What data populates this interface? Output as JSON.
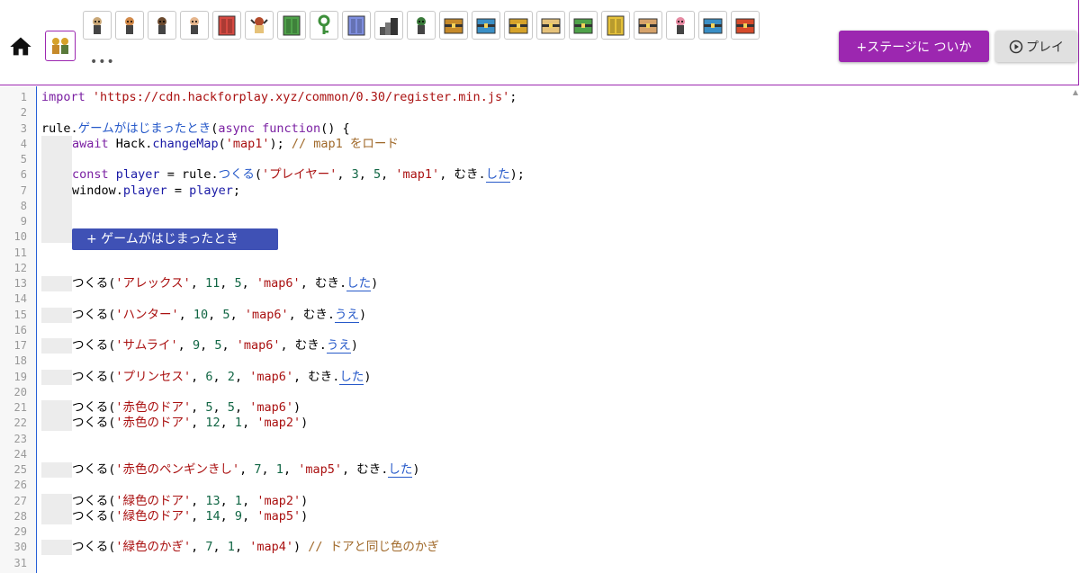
{
  "toolbar": {
    "add_stage_label": "+ステージに ついか",
    "play_label": "プレイ",
    "more_label": "•••",
    "assets": [
      {
        "name": "asset-person-1",
        "icon": "person",
        "color": "#c9a777"
      },
      {
        "name": "asset-person-2",
        "icon": "person",
        "color": "#d28a4a"
      },
      {
        "name": "asset-person-3",
        "icon": "person",
        "color": "#6b4a2f"
      },
      {
        "name": "asset-person-4",
        "icon": "person",
        "color": "#e5b58c"
      },
      {
        "name": "asset-red-door",
        "icon": "door",
        "color": "#d64a42"
      },
      {
        "name": "asset-penguin-knight",
        "icon": "knight",
        "color": "#b24a2a"
      },
      {
        "name": "asset-green-door",
        "icon": "door",
        "color": "#4fa24a"
      },
      {
        "name": "asset-green-key",
        "icon": "key",
        "color": "#3d8f3a"
      },
      {
        "name": "asset-blue-door",
        "icon": "door",
        "color": "#7f8fe0"
      },
      {
        "name": "asset-stairs",
        "icon": "stairs",
        "color": "#555555"
      },
      {
        "name": "asset-goblin",
        "icon": "person",
        "color": "#3a7a3a"
      },
      {
        "name": "asset-chest-1",
        "icon": "chest",
        "color": "#c68a2a"
      },
      {
        "name": "asset-chest-2",
        "icon": "chest",
        "color": "#3a8fc6"
      },
      {
        "name": "asset-chest-3",
        "icon": "chest",
        "color": "#d6a22a"
      },
      {
        "name": "asset-chest-4",
        "icon": "chest",
        "color": "#e6c27a"
      },
      {
        "name": "asset-chest-5",
        "icon": "chest",
        "color": "#4fa24a"
      },
      {
        "name": "asset-yellow-door",
        "icon": "door",
        "color": "#e6c23a"
      },
      {
        "name": "asset-chest-6",
        "icon": "chest",
        "color": "#d6a26a"
      },
      {
        "name": "asset-princess",
        "icon": "person",
        "color": "#e68aa2"
      },
      {
        "name": "asset-chest-7",
        "icon": "chest",
        "color": "#3a8fc6"
      },
      {
        "name": "asset-chest-8",
        "icon": "chest",
        "color": "#d64a2a"
      }
    ]
  },
  "editor": {
    "snippet_button_label": "+ ゲームがはじまったとき",
    "line_numbers": [
      "1",
      "2",
      "3",
      "4",
      "5",
      "6",
      "7",
      "8",
      "9",
      "10",
      "11",
      "12",
      "13",
      "14",
      "15",
      "16",
      "17",
      "18",
      "19",
      "20",
      "21",
      "22",
      "23",
      "24",
      "25",
      "26",
      "27",
      "28",
      "29",
      "30",
      "31"
    ],
    "lines": [
      {
        "n": 1,
        "indent": 0,
        "tokens": [
          [
            "kw",
            "import"
          ],
          [
            "",
            " "
          ],
          [
            "str",
            "'https://cdn.hackforplay.xyz/common/0.30/register.min.js'"
          ],
          [
            "",
            ";"
          ]
        ]
      },
      {
        "n": 2,
        "indent": 0,
        "tokens": []
      },
      {
        "n": 3,
        "indent": 0,
        "tokens": [
          [
            "",
            "rule."
          ],
          [
            "jp",
            "ゲームがはじまったとき"
          ],
          [
            "",
            "("
          ],
          [
            "kw",
            "async"
          ],
          [
            "",
            " "
          ],
          [
            "kw",
            "function"
          ],
          [
            "",
            "() {"
          ]
        ]
      },
      {
        "n": 4,
        "indent": 1,
        "tokens": [
          [
            "kw",
            "await"
          ],
          [
            "",
            " Hack."
          ],
          [
            "var",
            "changeMap"
          ],
          [
            "",
            "("
          ],
          [
            "str",
            "'map1'"
          ],
          [
            "",
            "); "
          ],
          [
            "cmt",
            "// map1 をロード"
          ]
        ]
      },
      {
        "n": 5,
        "indent": 1,
        "tokens": []
      },
      {
        "n": 6,
        "indent": 1,
        "tokens": [
          [
            "kw",
            "const"
          ],
          [
            "",
            " "
          ],
          [
            "var",
            "player"
          ],
          [
            "",
            " = rule."
          ],
          [
            "jp",
            "つくる"
          ],
          [
            "",
            "("
          ],
          [
            "str",
            "'プレイヤー'"
          ],
          [
            "",
            ", "
          ],
          [
            "num",
            "3"
          ],
          [
            "",
            ", "
          ],
          [
            "num",
            "5"
          ],
          [
            "",
            ", "
          ],
          [
            "str",
            "'map1'"
          ],
          [
            "",
            ", むき."
          ],
          [
            "ul",
            "した"
          ],
          [
            "",
            ");"
          ]
        ]
      },
      {
        "n": 7,
        "indent": 1,
        "tokens": [
          [
            "",
            "window."
          ],
          [
            "var",
            "player"
          ],
          [
            "",
            " = "
          ],
          [
            "var",
            "player"
          ],
          [
            "",
            ";"
          ]
        ]
      },
      {
        "n": 8,
        "indent": 1,
        "tokens": []
      },
      {
        "n": 9,
        "indent": 1,
        "tokens": []
      },
      {
        "n": 10,
        "indent": 1,
        "tokens": []
      },
      {
        "n": 11,
        "indent": 0,
        "tokens": []
      },
      {
        "n": 12,
        "indent": 0,
        "tokens": []
      },
      {
        "n": 13,
        "indent": 1,
        "tokens": [
          [
            "",
            "つくる("
          ],
          [
            "str",
            "'アレックス'"
          ],
          [
            "",
            ", "
          ],
          [
            "num",
            "11"
          ],
          [
            "",
            ", "
          ],
          [
            "num",
            "5"
          ],
          [
            "",
            ", "
          ],
          [
            "str",
            "'map6'"
          ],
          [
            "",
            ", むき."
          ],
          [
            "ul",
            "した"
          ],
          [
            "",
            ")"
          ]
        ]
      },
      {
        "n": 14,
        "indent": 0,
        "tokens": []
      },
      {
        "n": 15,
        "indent": 1,
        "tokens": [
          [
            "",
            "つくる("
          ],
          [
            "str",
            "'ハンター'"
          ],
          [
            "",
            ", "
          ],
          [
            "num",
            "10"
          ],
          [
            "",
            ", "
          ],
          [
            "num",
            "5"
          ],
          [
            "",
            ", "
          ],
          [
            "str",
            "'map6'"
          ],
          [
            "",
            ", むき."
          ],
          [
            "ul",
            "うえ"
          ],
          [
            "",
            ")"
          ]
        ]
      },
      {
        "n": 16,
        "indent": 0,
        "tokens": []
      },
      {
        "n": 17,
        "indent": 1,
        "tokens": [
          [
            "",
            "つくる("
          ],
          [
            "str",
            "'サムライ'"
          ],
          [
            "",
            ", "
          ],
          [
            "num",
            "9"
          ],
          [
            "",
            ", "
          ],
          [
            "num",
            "5"
          ],
          [
            "",
            ", "
          ],
          [
            "str",
            "'map6'"
          ],
          [
            "",
            ", むき."
          ],
          [
            "ul",
            "うえ"
          ],
          [
            "",
            ")"
          ]
        ]
      },
      {
        "n": 18,
        "indent": 0,
        "tokens": []
      },
      {
        "n": 19,
        "indent": 1,
        "tokens": [
          [
            "",
            "つくる("
          ],
          [
            "str",
            "'プリンセス'"
          ],
          [
            "",
            ", "
          ],
          [
            "num",
            "6"
          ],
          [
            "",
            ", "
          ],
          [
            "num",
            "2"
          ],
          [
            "",
            ", "
          ],
          [
            "str",
            "'map6'"
          ],
          [
            "",
            ", むき."
          ],
          [
            "ul",
            "した"
          ],
          [
            "",
            ")"
          ]
        ]
      },
      {
        "n": 20,
        "indent": 0,
        "tokens": []
      },
      {
        "n": 21,
        "indent": 1,
        "tokens": [
          [
            "",
            "つくる("
          ],
          [
            "str",
            "'赤色のドア'"
          ],
          [
            "",
            ", "
          ],
          [
            "num",
            "5"
          ],
          [
            "",
            ", "
          ],
          [
            "num",
            "5"
          ],
          [
            "",
            ", "
          ],
          [
            "str",
            "'map6'"
          ],
          [
            "",
            ")"
          ]
        ]
      },
      {
        "n": 22,
        "indent": 1,
        "tokens": [
          [
            "",
            "つくる("
          ],
          [
            "str",
            "'赤色のドア'"
          ],
          [
            "",
            ", "
          ],
          [
            "num",
            "12"
          ],
          [
            "",
            ", "
          ],
          [
            "num",
            "1"
          ],
          [
            "",
            ", "
          ],
          [
            "str",
            "'map2'"
          ],
          [
            "",
            ")"
          ]
        ]
      },
      {
        "n": 23,
        "indent": 0,
        "tokens": []
      },
      {
        "n": 24,
        "indent": 0,
        "tokens": []
      },
      {
        "n": 25,
        "indent": 1,
        "tokens": [
          [
            "",
            "つくる("
          ],
          [
            "str",
            "'赤色のペンギンきし'"
          ],
          [
            "",
            ", "
          ],
          [
            "num",
            "7"
          ],
          [
            "",
            ", "
          ],
          [
            "num",
            "1"
          ],
          [
            "",
            ", "
          ],
          [
            "str",
            "'map5'"
          ],
          [
            "",
            ", むき."
          ],
          [
            "ul",
            "した"
          ],
          [
            "",
            ")"
          ]
        ]
      },
      {
        "n": 26,
        "indent": 0,
        "tokens": []
      },
      {
        "n": 27,
        "indent": 1,
        "tokens": [
          [
            "",
            "つくる("
          ],
          [
            "str",
            "'緑色のドア'"
          ],
          [
            "",
            ", "
          ],
          [
            "num",
            "13"
          ],
          [
            "",
            ", "
          ],
          [
            "num",
            "1"
          ],
          [
            "",
            ", "
          ],
          [
            "str",
            "'map2'"
          ],
          [
            "",
            ")"
          ]
        ]
      },
      {
        "n": 28,
        "indent": 1,
        "tokens": [
          [
            "",
            "つくる("
          ],
          [
            "str",
            "'緑色のドア'"
          ],
          [
            "",
            ", "
          ],
          [
            "num",
            "14"
          ],
          [
            "",
            ", "
          ],
          [
            "num",
            "9"
          ],
          [
            "",
            ", "
          ],
          [
            "str",
            "'map5'"
          ],
          [
            "",
            ")"
          ]
        ]
      },
      {
        "n": 29,
        "indent": 0,
        "tokens": []
      },
      {
        "n": 30,
        "indent": 1,
        "tokens": [
          [
            "",
            "つくる("
          ],
          [
            "str",
            "'緑色のかぎ'"
          ],
          [
            "",
            ", "
          ],
          [
            "num",
            "7"
          ],
          [
            "",
            ", "
          ],
          [
            "num",
            "1"
          ],
          [
            "",
            ", "
          ],
          [
            "str",
            "'map4'"
          ],
          [
            "",
            ") "
          ],
          [
            "cmt",
            "// ドアと同じ色のかぎ"
          ]
        ]
      },
      {
        "n": 31,
        "indent": 0,
        "tokens": []
      }
    ]
  }
}
